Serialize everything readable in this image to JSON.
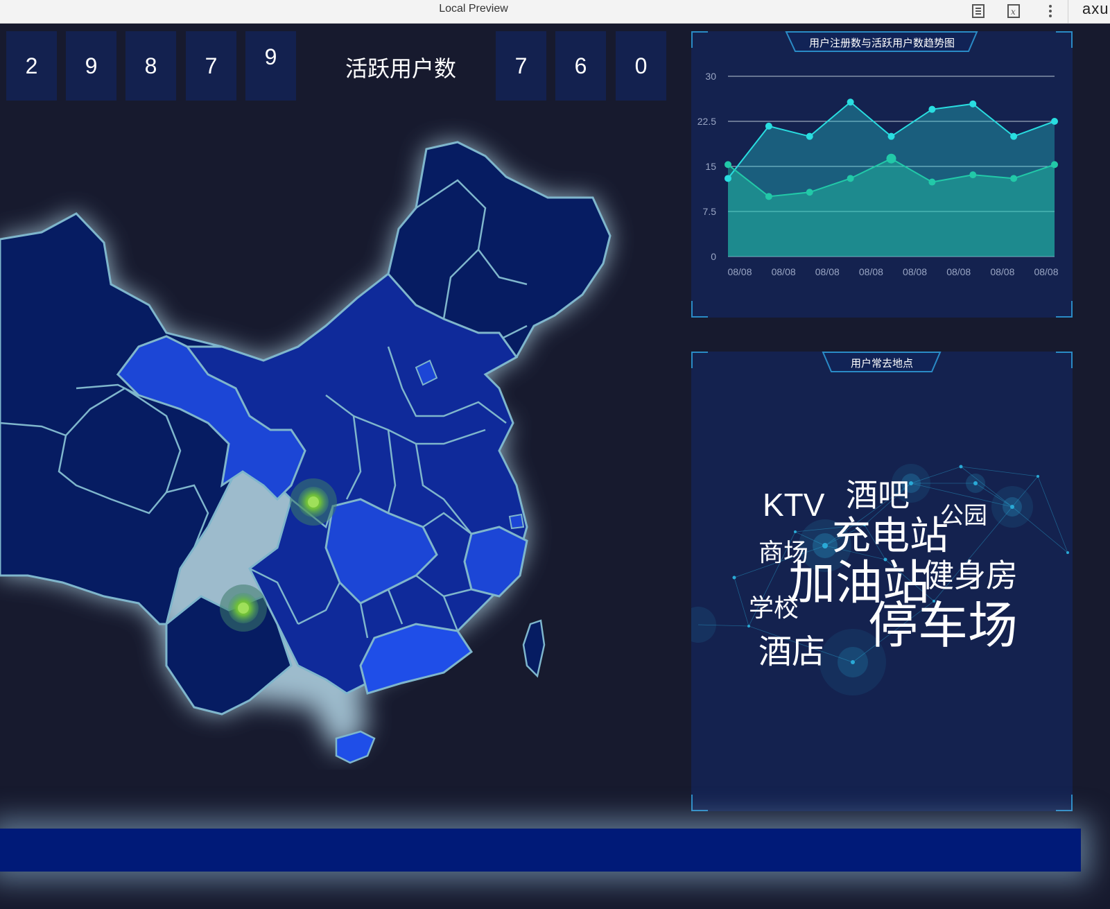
{
  "window": {
    "title": "Local Preview",
    "brand": "axu"
  },
  "counters": {
    "registered_digits": [
      "2",
      "9",
      "8",
      "7",
      "9"
    ],
    "active_label": "活跃用户数",
    "active_digits": [
      "7",
      "6",
      "0"
    ]
  },
  "trend_panel": {
    "title": "用户注册数与活跃用户数趋势图"
  },
  "places_panel": {
    "title": "用户常去地点",
    "words": [
      {
        "text": "KTV"
      },
      {
        "text": "酒吧"
      },
      {
        "text": "公园"
      },
      {
        "text": "充电站"
      },
      {
        "text": "商场"
      },
      {
        "text": "健身房"
      },
      {
        "text": "加油站"
      },
      {
        "text": "学校"
      },
      {
        "text": "停车场"
      },
      {
        "text": "酒店"
      }
    ]
  },
  "chart_data": {
    "type": "area",
    "title": "用户注册数与活跃用户数趋势图",
    "categories": [
      "08/08",
      "08/08",
      "08/08",
      "08/08",
      "08/08",
      "08/08",
      "08/08",
      "08/08",
      "08/08"
    ],
    "x_tick_labels": [
      "08/08",
      "08/08",
      "08/08",
      "08/08",
      "08/08",
      "08/08",
      "08/08",
      "08/08"
    ],
    "y_ticks": [
      "0",
      "7.5",
      "15",
      "22.5",
      "30"
    ],
    "ylim": [
      0,
      30
    ],
    "series": [
      {
        "values": [
          13,
          21.7,
          20,
          25.7,
          20,
          24.5,
          25.4,
          20,
          22.5
        ],
        "color": "#29dde0"
      },
      {
        "values": [
          15.3,
          10,
          10.7,
          13,
          16.3,
          12.4,
          13.6,
          13,
          15.3
        ],
        "color": "#22c9a8"
      }
    ],
    "grid": true,
    "legend": "none"
  },
  "colors": {
    "background": "#171a2e",
    "panel": "#14224f",
    "digit_box": "#13214f",
    "map_dark": "#061c62",
    "map_mid": "#0f2a9a",
    "map_light": "#1c46d6",
    "accent": "#2a8bc6"
  }
}
